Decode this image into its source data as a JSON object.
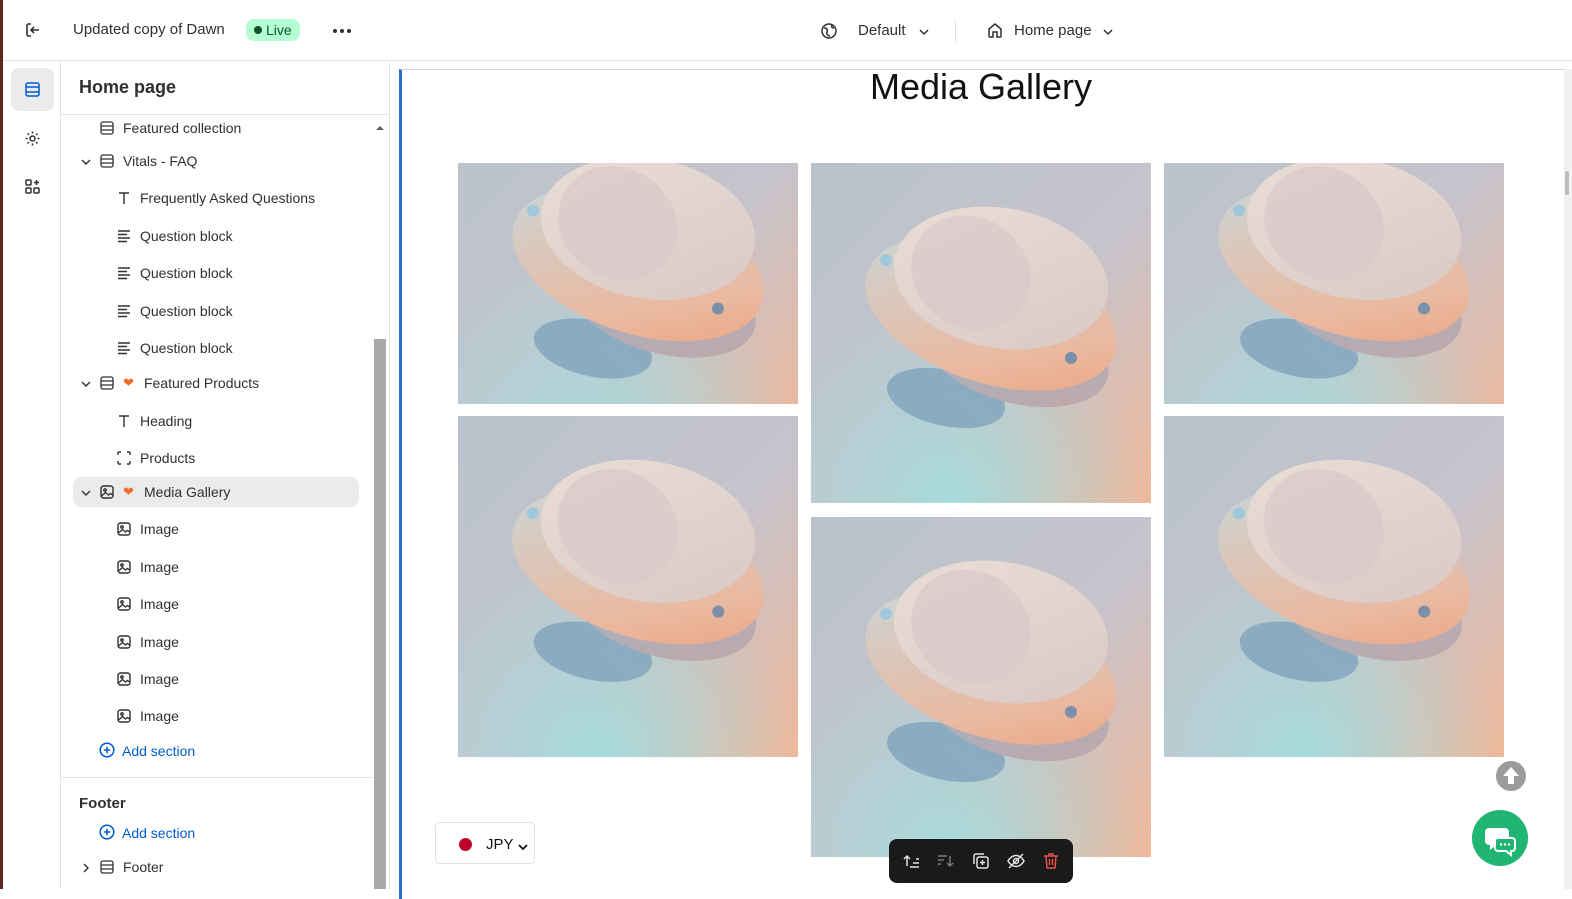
{
  "topbar": {
    "theme_name": "Updated copy of Dawn",
    "status_badge": "Live",
    "context_label": "Default",
    "template_label": "Home page"
  },
  "sidebar": {
    "title": "Home page",
    "items": [
      {
        "label": "Featured collection",
        "icon": "section-icon",
        "level": 0,
        "caret": false,
        "heart": false
      },
      {
        "label": "Vitals - FAQ",
        "icon": "section-icon",
        "level": 0,
        "caret": true,
        "heart": false
      },
      {
        "label": "Frequently Asked Questions",
        "icon": "text-icon",
        "level": 1
      },
      {
        "label": "Question block",
        "icon": "paragraph-icon",
        "level": 1
      },
      {
        "label": "Question block",
        "icon": "paragraph-icon",
        "level": 1
      },
      {
        "label": "Question block",
        "icon": "paragraph-icon",
        "level": 1
      },
      {
        "label": "Question block",
        "icon": "paragraph-icon",
        "level": 1
      },
      {
        "label": "Featured Products",
        "icon": "section-icon",
        "level": 0,
        "caret": true,
        "heart": true
      },
      {
        "label": "Heading",
        "icon": "text-icon",
        "level": 1
      },
      {
        "label": "Products",
        "icon": "frame-icon",
        "level": 1
      },
      {
        "label": "Media Gallery",
        "icon": "image-section-icon",
        "level": 0,
        "caret": true,
        "heart": true,
        "selected": true
      },
      {
        "label": "Image",
        "icon": "image-icon",
        "level": 1
      },
      {
        "label": "Image",
        "icon": "image-icon",
        "level": 1
      },
      {
        "label": "Image",
        "icon": "image-icon",
        "level": 1
      },
      {
        "label": "Image",
        "icon": "image-icon",
        "level": 1
      },
      {
        "label": "Image",
        "icon": "image-icon",
        "level": 1
      },
      {
        "label": "Image",
        "icon": "image-icon",
        "level": 1
      }
    ],
    "add_section_label": "Add section",
    "footer_title": "Footer",
    "footer_add_section_label": "Add section",
    "footer_item": "Footer"
  },
  "preview": {
    "gallery_title": "Media Gallery",
    "currency_code": "JPY"
  },
  "colors": {
    "accent": "#005bd3",
    "live_badge_bg": "#b4fed2",
    "selection_border": "#2c6ecb",
    "heart": "#f16d2a",
    "chat": "#21b573"
  }
}
